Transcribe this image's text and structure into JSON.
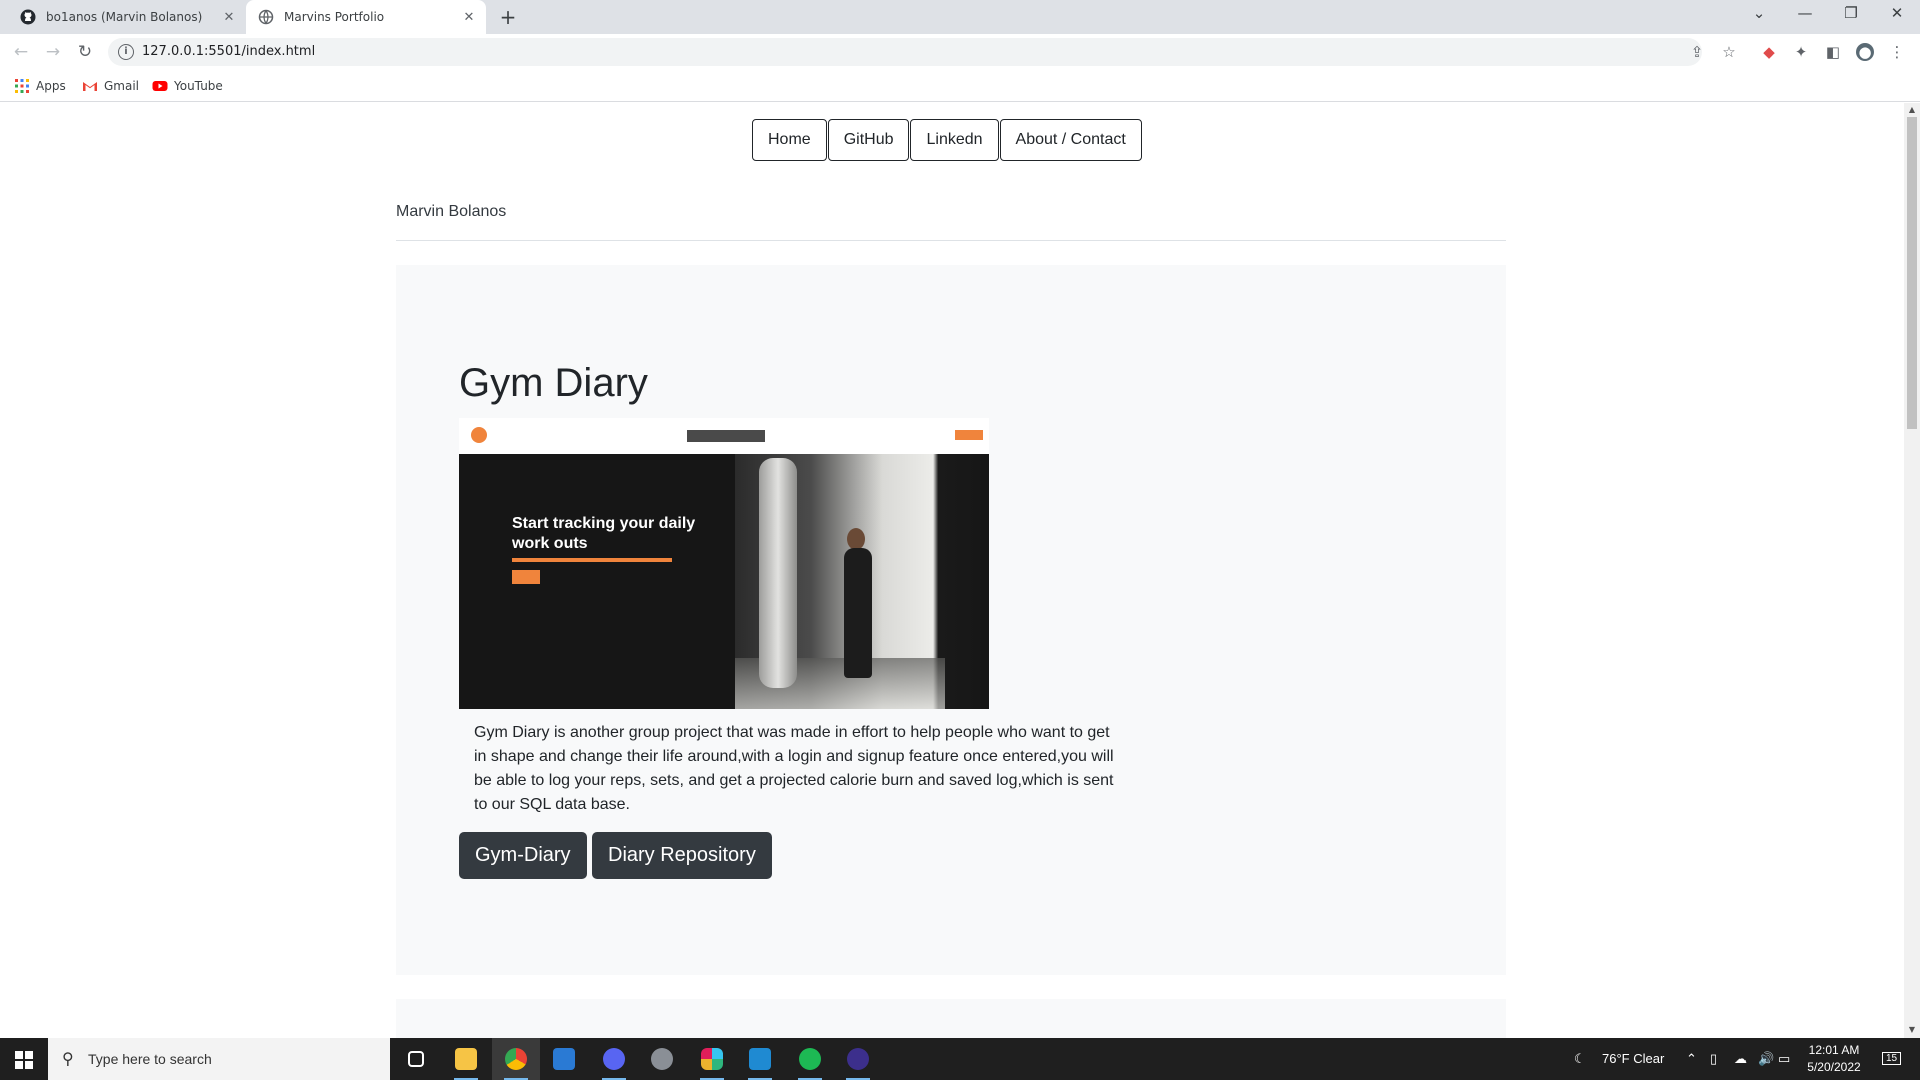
{
  "browser": {
    "tabs": [
      {
        "title": "bo1anos (Marvin Bolanos)",
        "active": false
      },
      {
        "title": "Marvins Portfolio",
        "active": true
      }
    ],
    "url": "127.0.0.1:5501/index.html",
    "bookmarks": [
      "Apps",
      "Gmail",
      "YouTube"
    ]
  },
  "site": {
    "nav": [
      "Home",
      "GitHub",
      "Linkedn",
      "About / Contact"
    ],
    "brand": "Marvin Bolanos",
    "project": {
      "title": "Gym Diary",
      "screenshot_headline": "Start tracking your daily work outs",
      "description": "Gym Diary is another group project that was made in effort to help people who want to get in shape and change their life around,with a login and signup feature once entered,you will be able to log your reps, sets, and get a projected calorie burn and saved log,which is sent to our SQL data base.",
      "buttons": [
        "Gym-Diary",
        "Diary Repository"
      ]
    }
  },
  "taskbar": {
    "search_placeholder": "Type here to search",
    "weather": "76°F  Clear",
    "time": "12:01 AM",
    "date": "5/20/2022",
    "notifications": "15"
  },
  "colors": {
    "accent_orange": "#f0843c",
    "button_dark": "#343a40",
    "card_bg": "#f8f9fa"
  }
}
